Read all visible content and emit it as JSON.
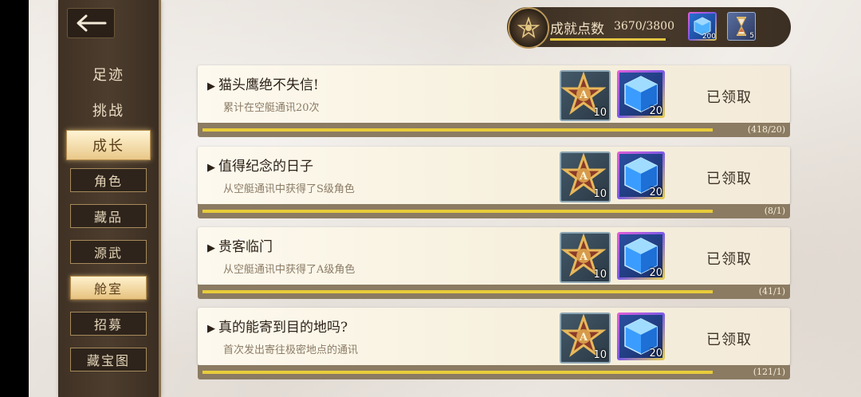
{
  "colors": {
    "accent_gold": "#e8cc3a",
    "sidebar": "#4d3d2e",
    "card": "#f6efdc"
  },
  "header": {
    "points_label": "成就点数",
    "points_value": "3670/3800",
    "points_progress": 0.966,
    "items": [
      {
        "icon": "blue-crystal-icon",
        "count": "200"
      },
      {
        "icon": "hourglass-icon",
        "count": "5"
      }
    ]
  },
  "sidebar": {
    "categories": [
      "足迹",
      "挑战",
      "成长"
    ],
    "active_category": "成长",
    "subcategories": [
      "角色",
      "藏品",
      "源武",
      "舱室",
      "招募",
      "藏宝图"
    ],
    "active_subcategory": "舱室"
  },
  "achievements": [
    {
      "title": "猫头鹰绝不失信!",
      "desc": "累计在空艇通讯20次",
      "reward_star_count": "10",
      "reward_crystal_count": "20",
      "status": "已领取",
      "progress": "(418/20)"
    },
    {
      "title": "值得纪念的日子",
      "desc": "从空艇通讯中获得了S级角色",
      "reward_star_count": "10",
      "reward_crystal_count": "20",
      "status": "已领取",
      "progress": "(8/1)"
    },
    {
      "title": "贵客临门",
      "desc": "从空艇通讯中获得了A级角色",
      "reward_star_count": "10",
      "reward_crystal_count": "20",
      "status": "已领取",
      "progress": "(41/1)"
    },
    {
      "title": "真的能寄到目的地吗?",
      "desc": "首次发出寄往极密地点的通讯",
      "reward_star_count": "10",
      "reward_crystal_count": "20",
      "status": "已领取",
      "progress": "(121/1)"
    }
  ]
}
